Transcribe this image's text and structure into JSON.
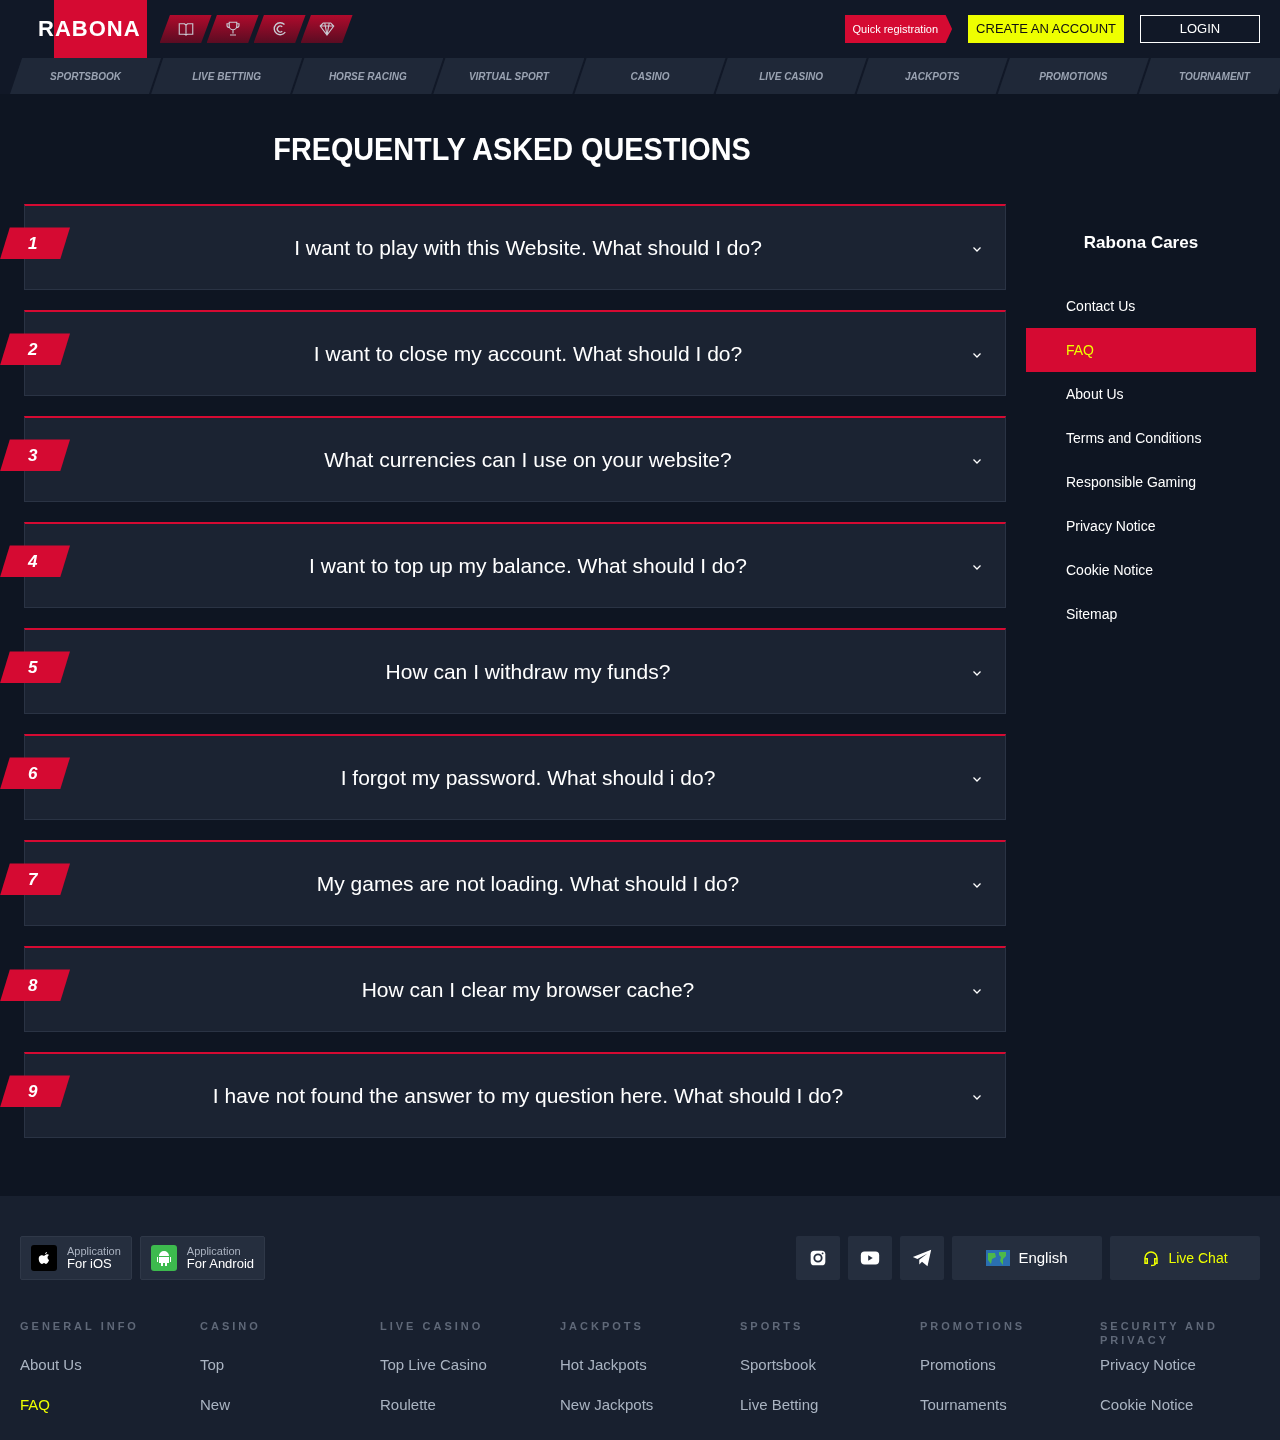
{
  "header": {
    "logo": "RABONA",
    "quick_registration": "Quick registration",
    "create_account": "CREATE AN ACCOUNT",
    "login": "LOGIN"
  },
  "nav": [
    {
      "label": "SPORTSBOOK"
    },
    {
      "label": "LIVE BETTING"
    },
    {
      "label": "HORSE RACING"
    },
    {
      "label": "VIRTUAL SPORT"
    },
    {
      "label": "CASINO"
    },
    {
      "label": "LIVE CASINO"
    },
    {
      "label": "JACKPOTS"
    },
    {
      "label": "PROMOTIONS"
    },
    {
      "label": "TOURNAMENT"
    }
  ],
  "title": "FREQUENTLY ASKED QUESTIONS",
  "faq": [
    {
      "number": "1",
      "question": "I want to play with this Website. What should I do?",
      "expanded": false
    },
    {
      "number": "2",
      "question": "I want to close my account. What should I do?",
      "expanded": false
    },
    {
      "number": "3",
      "question": "What currencies can I use on your website?",
      "expanded": false
    },
    {
      "number": "4",
      "question": "I want to top up my balance. What should I do?",
      "expanded": false
    },
    {
      "number": "5",
      "question": "How can I withdraw my funds?",
      "expanded": false
    },
    {
      "number": "6",
      "question": "I forgot my password. What should i do?",
      "expanded": false
    },
    {
      "number": "7",
      "question": "My games are not loading. What should I do?",
      "expanded": false
    },
    {
      "number": "8",
      "question": "How can I clear my browser cache?",
      "expanded": false
    },
    {
      "number": "9",
      "question": "I have not found the answer to my question here. What should I do?",
      "expanded": false
    }
  ],
  "sidebar": {
    "title": "Rabona Cares",
    "items": [
      {
        "label": "Contact Us",
        "selected": false
      },
      {
        "label": "FAQ",
        "selected": true
      },
      {
        "label": "About Us",
        "selected": false
      },
      {
        "label": "Terms and Conditions",
        "selected": false
      },
      {
        "label": "Responsible Gaming",
        "selected": false
      },
      {
        "label": "Privacy Notice",
        "selected": false
      },
      {
        "label": "Cookie Notice",
        "selected": false
      },
      {
        "label": "Sitemap",
        "selected": false
      }
    ]
  },
  "footer": {
    "apps": [
      {
        "kind": "ios",
        "line1": "Application",
        "line2": "For iOS"
      },
      {
        "kind": "android",
        "line1": "Application",
        "line2": "For Android"
      }
    ],
    "language": "English",
    "live_chat": "Live Chat",
    "columns": [
      {
        "heading": "GENERAL INFO",
        "links": [
          {
            "label": "About Us",
            "selected": false
          },
          {
            "label": "FAQ",
            "selected": true
          }
        ]
      },
      {
        "heading": "CASINO",
        "links": [
          {
            "label": "Top",
            "selected": false
          },
          {
            "label": "New",
            "selected": false
          }
        ]
      },
      {
        "heading": "LIVE CASINO",
        "links": [
          {
            "label": "Top Live Casino",
            "selected": false
          },
          {
            "label": "Roulette",
            "selected": false
          }
        ]
      },
      {
        "heading": "JACKPOTS",
        "links": [
          {
            "label": "Hot Jackpots",
            "selected": false
          },
          {
            "label": "New Jackpots",
            "selected": false
          }
        ]
      },
      {
        "heading": "SPORTS",
        "links": [
          {
            "label": "Sportsbook",
            "selected": false
          },
          {
            "label": "Live Betting",
            "selected": false
          }
        ]
      },
      {
        "heading": "PROMOTIONS",
        "links": [
          {
            "label": "Promotions",
            "selected": false
          },
          {
            "label": "Tournaments",
            "selected": false
          }
        ]
      },
      {
        "heading": "SECURITY AND PRIVACY",
        "links": [
          {
            "label": "Privacy Notice",
            "selected": false
          },
          {
            "label": "Cookie Notice",
            "selected": false
          }
        ]
      }
    ]
  }
}
